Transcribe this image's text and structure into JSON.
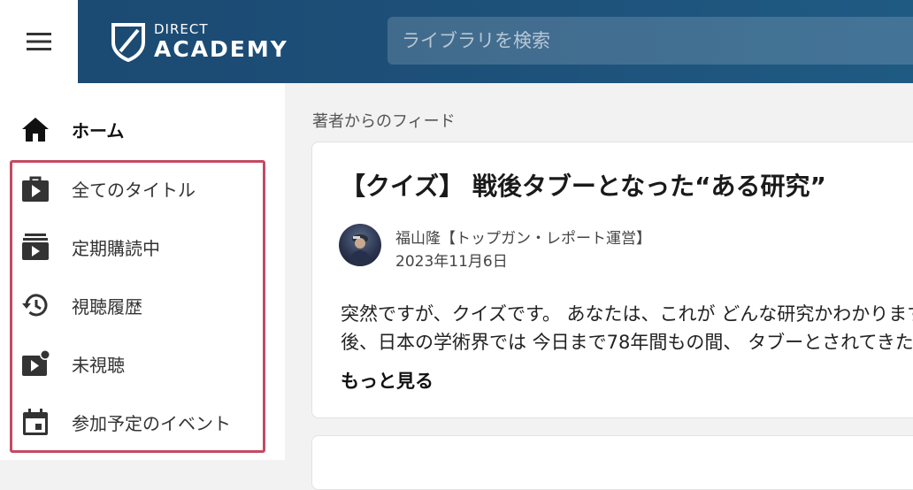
{
  "header": {
    "logo_small": "DIRECT",
    "logo_big": "ACADEMY",
    "search_placeholder": "ライブラリを検索"
  },
  "sidebar": {
    "items": [
      {
        "label": "ホーム",
        "icon": "home-icon"
      },
      {
        "label": "全てのタイトル",
        "icon": "play-bag-icon"
      },
      {
        "label": "定期購読中",
        "icon": "subscriptions-icon"
      },
      {
        "label": "視聴履歴",
        "icon": "history-icon"
      },
      {
        "label": "未視聴",
        "icon": "unwatched-icon"
      },
      {
        "label": "参加予定のイベント",
        "icon": "calendar-icon"
      }
    ]
  },
  "feed": {
    "heading": "著者からのフィード",
    "post": {
      "title": "【クイズ】 戦後タブーとなった“ある研究”",
      "author": "福山隆【トップガン・レポート運営】",
      "date": "2023年11月6日",
      "body_line1": "突然ですが、クイズです。 あなたは、これが どんな研究かわかりますか？",
      "body_line2": "後、日本の学術界では 今日まで78年間もの間、 タブーとされてきた研究です。",
      "more": "もっと見る"
    }
  },
  "colors": {
    "header_bg": "#1d4f78",
    "highlight_border": "#c44a63",
    "sidebar_bg": "#ffffff",
    "page_bg": "#f2f2f2"
  }
}
